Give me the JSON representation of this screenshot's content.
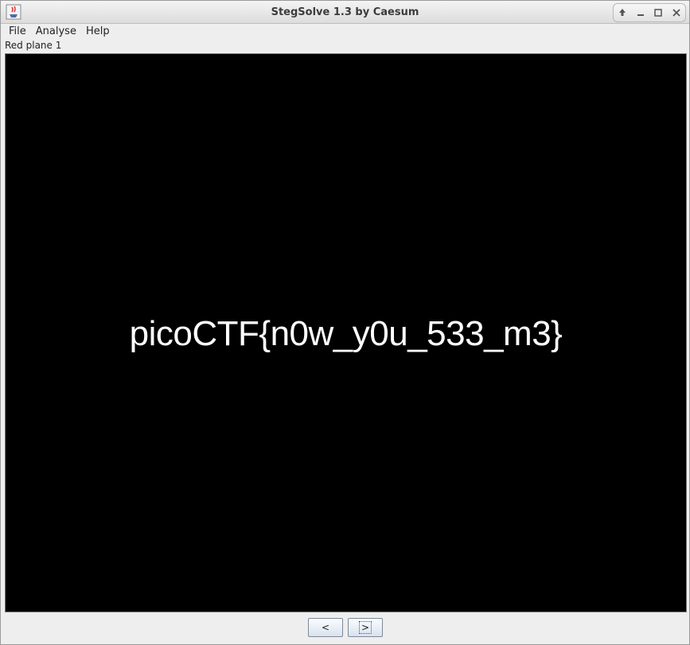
{
  "window": {
    "title": "StegSolve 1.3 by Caesum"
  },
  "menu": {
    "items": [
      "File",
      "Analyse",
      "Help"
    ]
  },
  "status": {
    "plane_label": "Red plane 1"
  },
  "image": {
    "flag_text": "picoCTF{n0w_y0u_533_m3}"
  },
  "nav": {
    "prev_label": "<",
    "next_label": ">"
  },
  "icons": {
    "app": "java-cup-icon",
    "controls": [
      "pin-icon",
      "minimize-icon",
      "maximize-icon",
      "close-icon"
    ]
  },
  "colors": {
    "canvas": "#000000",
    "text": "#ffffff",
    "chrome": "#eeeeee"
  }
}
